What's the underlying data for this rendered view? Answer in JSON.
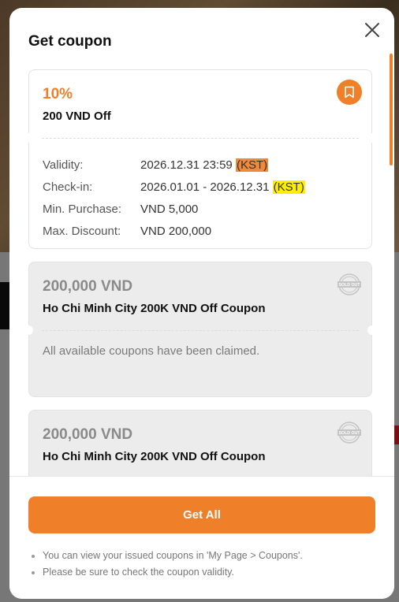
{
  "modal": {
    "title": "Get coupon"
  },
  "coupons": [
    {
      "amount": "10%",
      "name": "200 VND Off",
      "status": "available",
      "details": {
        "validity_label": "Validity:",
        "validity_value": "2026.12.31 23:59",
        "validity_tz": "(KST)",
        "checkin_label": "Check-in:",
        "checkin_value": "2026.01.01 - 2026.12.31",
        "checkin_tz": "(KST)",
        "min_label": "Min. Purchase:",
        "min_value": "VND 5,000",
        "max_label": "Max. Discount:",
        "max_value": "VND 200,000"
      }
    },
    {
      "amount": "200,000 VND",
      "name": "Ho Chi Minh City 200K VND Off Coupon",
      "status": "sold-out",
      "message": "All available coupons have been claimed.",
      "stamp_text": "SOLD OUT"
    },
    {
      "amount": "200,000 VND",
      "name": "Ho Chi Minh City 200K VND Off Coupon",
      "status": "sold-out",
      "stamp_text": "SOLD OUT"
    }
  ],
  "footer": {
    "get_all_label": "Get All",
    "notes": [
      "You can view your issued coupons in 'My Page > Coupons'.",
      "Please be sure to check the coupon validity."
    ]
  },
  "colors": {
    "accent": "#f07f2a",
    "highlight_orange": "#f08a3a",
    "highlight_yellow": "#ffee00",
    "soldout_bg": "#ececec"
  },
  "icons": {
    "close": "close-icon",
    "bookmark": "bookmark-icon",
    "soldout": "sold-out-stamp-icon"
  }
}
